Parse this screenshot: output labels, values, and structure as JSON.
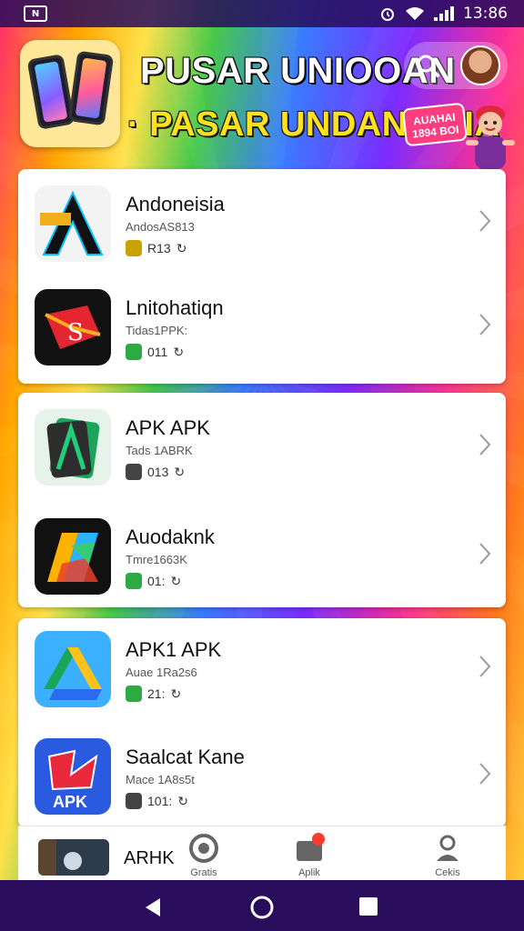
{
  "status": {
    "time": "13:86",
    "left_icon": "N"
  },
  "header": {
    "title_line1": "PUSAR UNIOOAN",
    "title_line2": "· PASAR UNDANEISIA",
    "promo_badge": "AUAHAI 1894 BOI"
  },
  "apps": [
    {
      "name": "Andoneisia",
      "sub": "AndosAS813",
      "meta": "R13",
      "tag_color": "#c8a200"
    },
    {
      "name": "Lnitohatiqn",
      "sub": "Tidas1PPK:",
      "meta": "011",
      "tag_color": "#2eaa44"
    },
    {
      "name": "APK APK",
      "sub": "Tads 1ABRK",
      "meta": "013",
      "tag_color": "#444444"
    },
    {
      "name": "Auodaknk",
      "sub": "Tmre1663K",
      "meta": "01:",
      "tag_color": "#2eaa44"
    },
    {
      "name": "APK1 APK",
      "sub": "Auae 1Ra2s6",
      "meta": "21:",
      "tag_color": "#2eaa44"
    },
    {
      "name": "Saalcat Kane",
      "sub": "Mace 1A8s5t",
      "meta": "101:",
      "tag_color": "#444444"
    }
  ],
  "bottom_nav": {
    "partial_app_label": "ARHK",
    "items": [
      "Gratis",
      "Aplik",
      "Cekis"
    ]
  },
  "colors": {
    "status_bg": "#2a0c5c",
    "title_yellow": "#ffe21f"
  }
}
